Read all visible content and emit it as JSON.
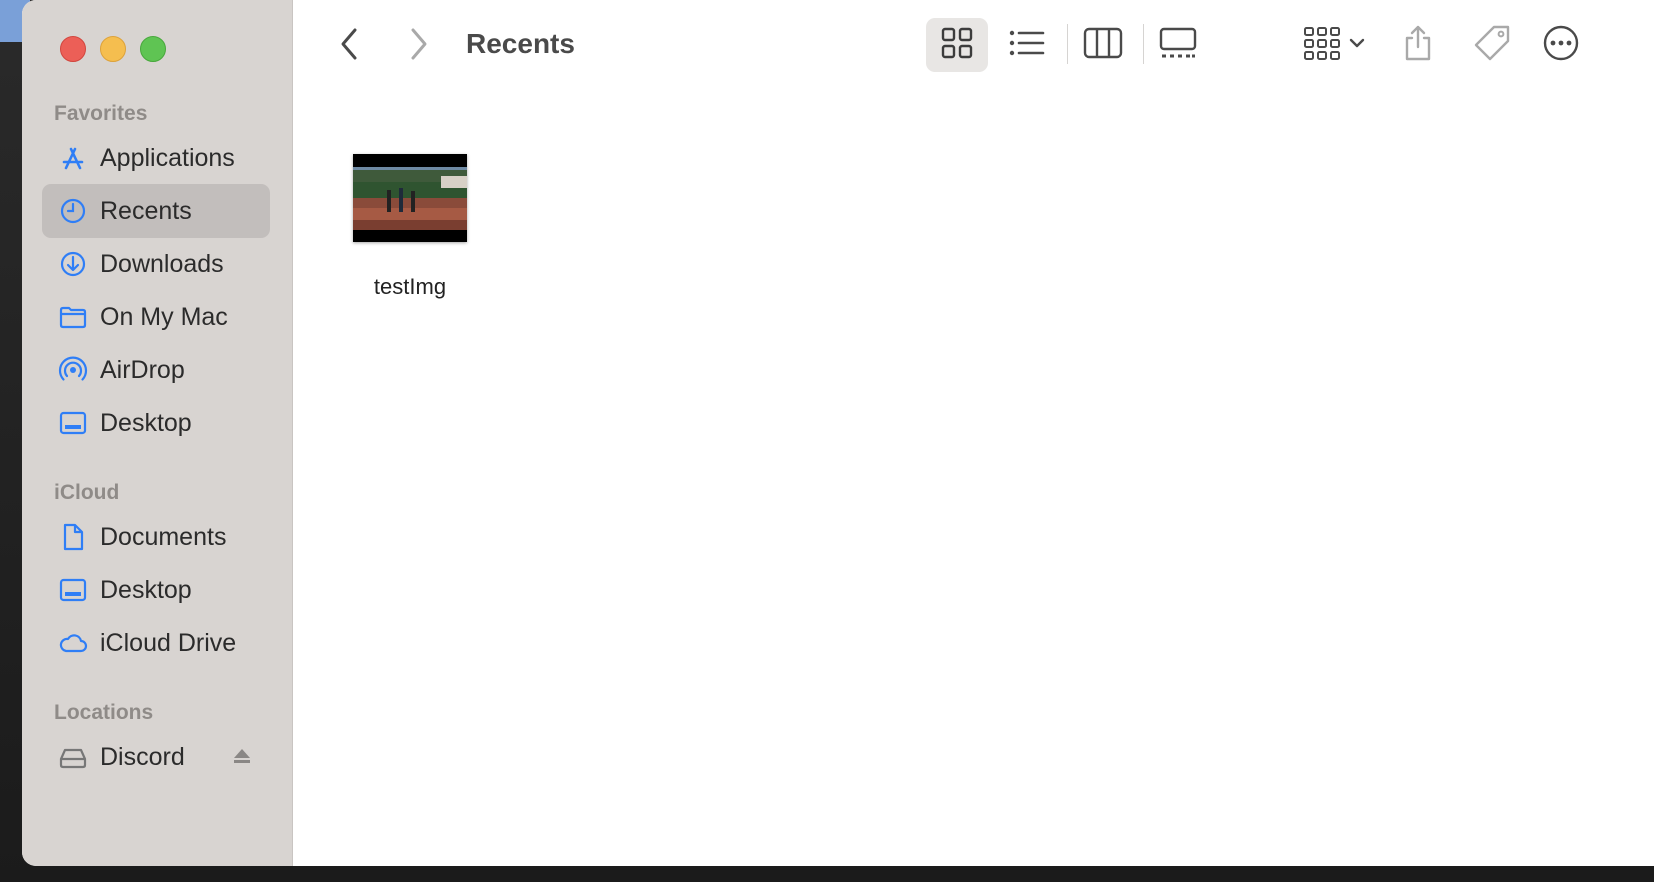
{
  "window": {
    "title": "Recents"
  },
  "sidebar": {
    "sections": [
      {
        "label": "Favorites"
      },
      {
        "label": "iCloud"
      },
      {
        "label": "Locations"
      }
    ],
    "favorites": [
      {
        "label": "Applications",
        "icon": "applications-icon"
      },
      {
        "label": "Recents",
        "icon": "clock-icon",
        "selected": true
      },
      {
        "label": "Downloads",
        "icon": "download-icon"
      },
      {
        "label": "On My Mac",
        "icon": "folder-icon"
      },
      {
        "label": "AirDrop",
        "icon": "airdrop-icon"
      },
      {
        "label": "Desktop",
        "icon": "desktop-icon"
      }
    ],
    "icloud": [
      {
        "label": "Documents",
        "icon": "document-icon"
      },
      {
        "label": "Desktop",
        "icon": "desktop-icon"
      },
      {
        "label": "iCloud Drive",
        "icon": "cloud-icon"
      }
    ],
    "locations": [
      {
        "label": "Discord",
        "icon": "drive-icon",
        "ejectable": true
      }
    ]
  },
  "toolbar": {
    "views": [
      "icon-view",
      "list-view",
      "column-view",
      "gallery-view"
    ],
    "active_view": "icon-view"
  },
  "files": [
    {
      "name": "testImg"
    }
  ],
  "colors": {
    "accent": "#2f7ef6",
    "sidebar_bg": "#d8d4d1",
    "selection_bg": "#c2bebc"
  }
}
